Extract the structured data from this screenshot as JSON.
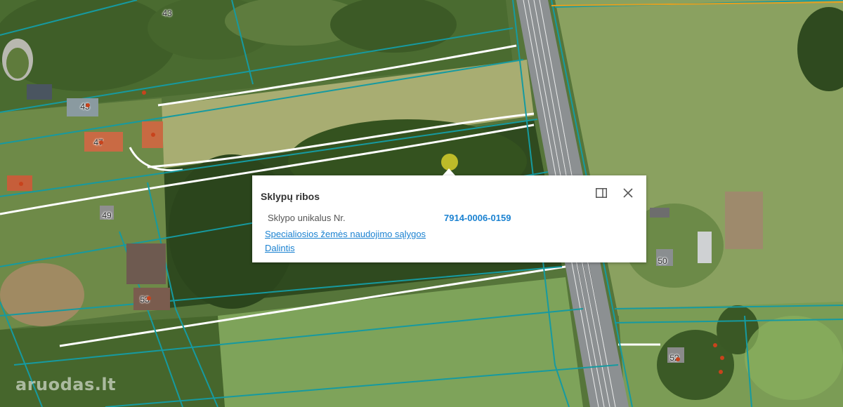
{
  "map": {
    "parcel_line_color": "#169aa0",
    "road_color": "#ffffff",
    "railway_color": "#9aa0a4",
    "labels": [
      "43",
      "45",
      "47",
      "49",
      "53",
      "50",
      "52"
    ]
  },
  "popup": {
    "title": "Sklypų ribos",
    "field_label": "Sklypo unikalus Nr.",
    "field_value": "7914-0006-0159",
    "links": [
      "Specialiosios žemės naudojimo sąlygos",
      "Dalintis"
    ],
    "dock_icon": "dock-panel-icon",
    "close_icon": "close-icon"
  },
  "watermark": "aruodas.lt"
}
